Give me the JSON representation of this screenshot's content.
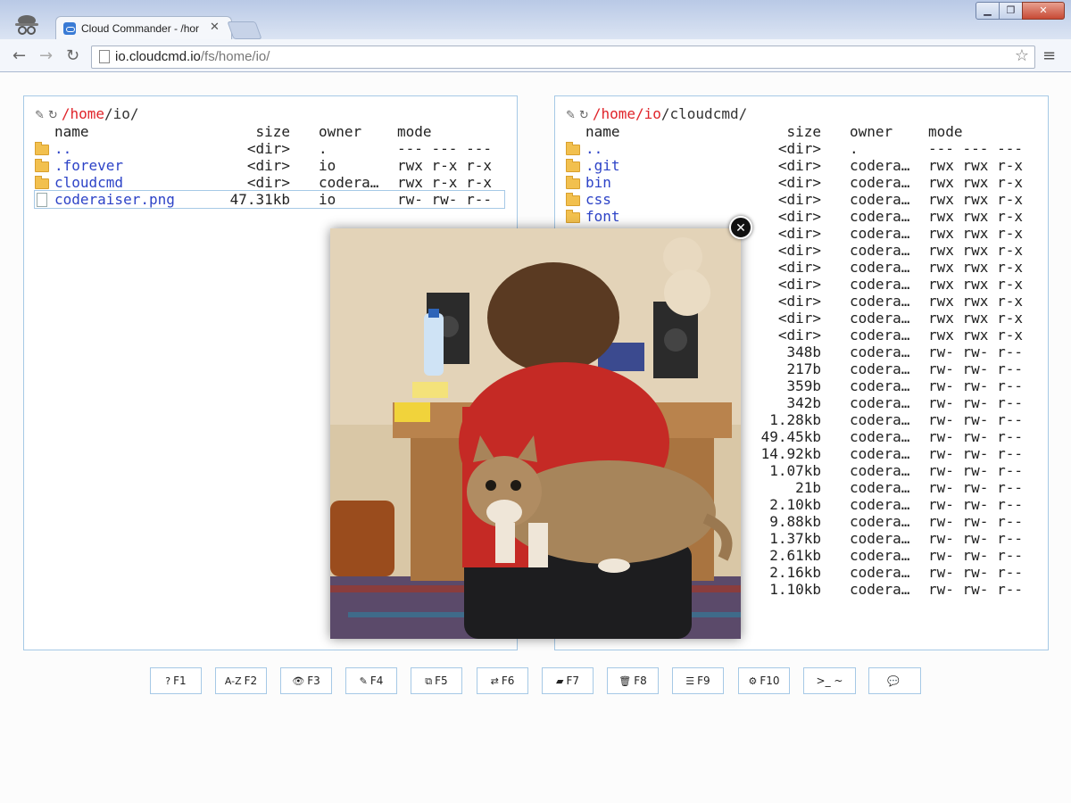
{
  "browser": {
    "tab_title": "Cloud Commander - /hor",
    "tab_close": "✕",
    "url_host": "io.cloudcmd.io",
    "url_path": "/fs/home/io/",
    "star_icon": "star-icon",
    "menu_icon": "hamburger-menu-icon",
    "window_buttons": {
      "minimize": "▁",
      "maximize": "❐",
      "close": "✕"
    }
  },
  "left_panel": {
    "path": {
      "segments": [
        "/home",
        "/io/"
      ]
    },
    "headers": {
      "name": "name",
      "size": "size",
      "owner": "owner",
      "mode": "mode"
    },
    "files": [
      {
        "name": "..",
        "size": "<dir>",
        "owner": ".",
        "mode": "--- --- ---",
        "type": "dir"
      },
      {
        "name": ".forever",
        "size": "<dir>",
        "owner": "io",
        "mode": "rwx r-x r-x",
        "type": "dir"
      },
      {
        "name": "cloudcmd",
        "size": "<dir>",
        "owner": "codera…",
        "mode": "rwx r-x r-x",
        "type": "dir"
      },
      {
        "name": "coderaiser.png",
        "size": "47.31kb",
        "owner": "io",
        "mode": "rw- rw- r--",
        "type": "file",
        "selected": true
      }
    ]
  },
  "right_panel": {
    "path": {
      "segments": [
        "/home",
        "/io",
        "/cloudcmd/"
      ]
    },
    "headers": {
      "name": "name",
      "size": "size",
      "owner": "owner",
      "mode": "mode"
    },
    "files": [
      {
        "name": "..",
        "size": "<dir>",
        "owner": ".",
        "mode": "--- --- ---",
        "type": "dir"
      },
      {
        "name": ".git",
        "size": "<dir>",
        "owner": "codera…",
        "mode": "rwx rwx r-x",
        "type": "dir"
      },
      {
        "name": "bin",
        "size": "<dir>",
        "owner": "codera…",
        "mode": "rwx rwx r-x",
        "type": "dir"
      },
      {
        "name": "css",
        "size": "<dir>",
        "owner": "codera…",
        "mode": "rwx rwx r-x",
        "type": "dir"
      },
      {
        "name": "font",
        "size": "<dir>",
        "owner": "codera…",
        "mode": "rwx rwx r-x",
        "type": "dir"
      },
      {
        "name": "",
        "size": "<dir>",
        "owner": "codera…",
        "mode": "rwx rwx r-x",
        "type": "hidden"
      },
      {
        "name": "",
        "size": "<dir>",
        "owner": "codera…",
        "mode": "rwx rwx r-x",
        "type": "hidden"
      },
      {
        "name": "",
        "size": "<dir>",
        "owner": "codera…",
        "mode": "rwx rwx r-x",
        "type": "hidden"
      },
      {
        "name": "",
        "size": "<dir>",
        "owner": "codera…",
        "mode": "rwx rwx r-x",
        "type": "hidden"
      },
      {
        "name": "",
        "size": "<dir>",
        "owner": "codera…",
        "mode": "rwx rwx r-x",
        "type": "hidden"
      },
      {
        "name": "",
        "size": "<dir>",
        "owner": "codera…",
        "mode": "rwx rwx r-x",
        "type": "hidden"
      },
      {
        "name": "",
        "size": "<dir>",
        "owner": "codera…",
        "mode": "rwx rwx r-x",
        "type": "hidden"
      },
      {
        "name": "",
        "size": "348b",
        "owner": "codera…",
        "mode": "rw- rw- r--",
        "type": "hidden"
      },
      {
        "name": "",
        "size": "217b",
        "owner": "codera…",
        "mode": "rw- rw- r--",
        "type": "hidden"
      },
      {
        "name": "",
        "size": "359b",
        "owner": "codera…",
        "mode": "rw- rw- r--",
        "type": "hidden"
      },
      {
        "name": "",
        "size": "342b",
        "owner": "codera…",
        "mode": "rw- rw- r--",
        "type": "hidden"
      },
      {
        "name": "",
        "size": "1.28kb",
        "owner": "codera…",
        "mode": "rw- rw- r--",
        "type": "hidden"
      },
      {
        "name": "",
        "size": "49.45kb",
        "owner": "codera…",
        "mode": "rw- rw- r--",
        "type": "hidden"
      },
      {
        "name": "",
        "size": "14.92kb",
        "owner": "codera…",
        "mode": "rw- rw- r--",
        "type": "hidden"
      },
      {
        "name": "",
        "size": "1.07kb",
        "owner": "codera…",
        "mode": "rw- rw- r--",
        "type": "hidden"
      },
      {
        "name": "",
        "size": "21b",
        "owner": "codera…",
        "mode": "rw- rw- r--",
        "type": "hidden"
      },
      {
        "name": "",
        "size": "2.10kb",
        "owner": "codera…",
        "mode": "rw- rw- r--",
        "type": "hidden"
      },
      {
        "name": "",
        "size": "9.88kb",
        "owner": "codera…",
        "mode": "rw- rw- r--",
        "type": "hidden"
      },
      {
        "name": "",
        "size": "1.37kb",
        "owner": "codera…",
        "mode": "rw- rw- r--",
        "type": "hidden"
      },
      {
        "name": "",
        "size": "2.61kb",
        "owner": "codera…",
        "mode": "rw- rw- r--",
        "type": "hidden"
      },
      {
        "name": "",
        "size": "2.16kb",
        "owner": "codera…",
        "mode": "rw- rw- r--",
        "type": "hidden"
      },
      {
        "name": "",
        "size": "1.10kb",
        "owner": "codera…",
        "mode": "rw- rw- r--",
        "type": "hidden"
      }
    ]
  },
  "viewer": {
    "close_label": "✕",
    "image": "coderaiser-photo-cat-on-chair"
  },
  "function_keys": [
    {
      "label": "F1",
      "icon": "?",
      "icon_name": "help-icon"
    },
    {
      "label": "F2",
      "icon": "A-Z",
      "icon_name": "rename-icon"
    },
    {
      "label": "F3",
      "icon": "👁",
      "icon_name": "view-eye-icon"
    },
    {
      "label": "F4",
      "icon": "✎",
      "icon_name": "edit-icon"
    },
    {
      "label": "F5",
      "icon": "⧉",
      "icon_name": "copy-icon"
    },
    {
      "label": "F6",
      "icon": "⇄",
      "icon_name": "move-icon"
    },
    {
      "label": "F7",
      "icon": "▰",
      "icon_name": "new-folder-icon"
    },
    {
      "label": "F8",
      "icon": "🗑",
      "icon_name": "delete-trash-icon"
    },
    {
      "label": "F9",
      "icon": "☰",
      "icon_name": "menu-icon"
    },
    {
      "label": "F10",
      "icon": "⚙",
      "icon_name": "settings-gear-icon"
    },
    {
      "label": ">_ ~",
      "icon": "",
      "icon_name": "console-icon"
    },
    {
      "label": "",
      "icon": "💬",
      "icon_name": "contact-chat-icon"
    }
  ],
  "colors": {
    "path_red": "#e0242a",
    "link_blue": "#2d43c7",
    "panel_border": "#a6c9e6"
  }
}
